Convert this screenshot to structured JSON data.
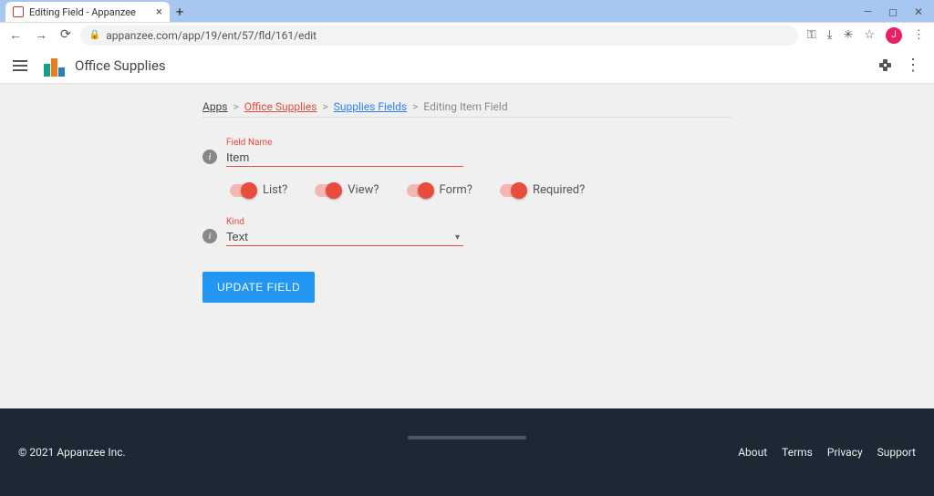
{
  "browser": {
    "tab_title": "Editing Field - Appanzee",
    "url": "appanzee.com/app/19/ent/57/fld/161/edit",
    "avatar_initial": "J"
  },
  "header": {
    "app_title": "Office Supplies"
  },
  "breadcrumbs": {
    "apps": "Apps",
    "office_supplies": "Office Supplies",
    "supplies_fields": "Supplies Fields",
    "current": "Editing Item Field"
  },
  "form": {
    "field_name_label": "Field Name",
    "field_name_value": "Item",
    "toggles": {
      "list": "List?",
      "view": "View?",
      "form": "Form?",
      "required": "Required?"
    },
    "kind_label": "Kind",
    "kind_value": "Text",
    "submit": "UPDATE FIELD"
  },
  "footer": {
    "copyright": "© 2021 Appanzee Inc.",
    "links": {
      "about": "About",
      "terms": "Terms",
      "privacy": "Privacy",
      "support": "Support"
    }
  }
}
